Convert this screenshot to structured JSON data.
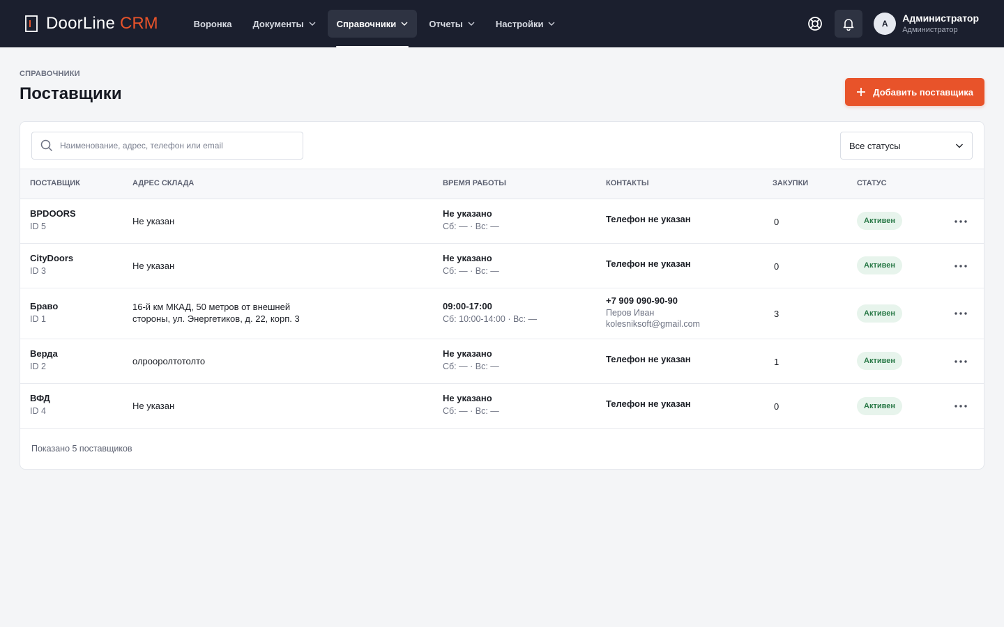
{
  "brand": {
    "name": "DoorLine",
    "accent": "CRM",
    "accent_color": "#e8532a"
  },
  "nav": [
    {
      "label": "Воронка",
      "dropdown": false,
      "active": false
    },
    {
      "label": "Документы",
      "dropdown": true,
      "active": false
    },
    {
      "label": "Справочники",
      "dropdown": true,
      "active": true
    },
    {
      "label": "Отчеты",
      "dropdown": true,
      "active": false
    },
    {
      "label": "Настройки",
      "dropdown": true,
      "active": false
    }
  ],
  "user": {
    "initial": "А",
    "name": "Администратор",
    "role": "Администратор"
  },
  "page": {
    "breadcrumb": "СПРАВОЧНИКИ",
    "title": "Поставщики",
    "add_button": "Добавить поставщика"
  },
  "search": {
    "placeholder": "Наименование, адрес, телефон или email",
    "value": ""
  },
  "status_filter": {
    "selected": "Все статусы"
  },
  "table": {
    "headers": [
      "ПОСТАВЩИК",
      "АДРЕС СКЛАДА",
      "ВРЕМЯ РАБОТЫ",
      "КОНТАКТЫ",
      "ЗАКУПКИ",
      "СТАТУС"
    ],
    "rows": [
      {
        "name": "BPDOORS",
        "id": "ID 5",
        "address": "Не указан",
        "hours": "Не указано",
        "weekend": "Сб: — · Вс: —",
        "phone": "Телефон не указан",
        "contact_person": "",
        "email": "",
        "purchases": "0",
        "status": "Активен"
      },
      {
        "name": "CityDoors",
        "id": "ID 3",
        "address": "Не указан",
        "hours": "Не указано",
        "weekend": "Сб: — · Вс: —",
        "phone": "Телефон не указан",
        "contact_person": "",
        "email": "",
        "purchases": "0",
        "status": "Активен"
      },
      {
        "name": "Браво",
        "id": "ID 1",
        "address": "16-й км МКАД, 50 метров от внешней стороны, ул. Энергетиков, д. 22, корп. 3",
        "hours": "09:00-17:00",
        "weekend": "Сб: 10:00-14:00 · Вс: —",
        "phone": "+7 909 090-90-90",
        "contact_person": "Перов Иван",
        "email": "kolesniksoft@gmail.com",
        "purchases": "3",
        "status": "Активен"
      },
      {
        "name": "Верда",
        "id": "ID 2",
        "address": "олрооролтотолто",
        "hours": "Не указано",
        "weekend": "Сб: — · Вс: —",
        "phone": "Телефон не указан",
        "contact_person": "",
        "email": "",
        "purchases": "1",
        "status": "Активен"
      },
      {
        "name": "ВФД",
        "id": "ID 4",
        "address": "Не указан",
        "hours": "Не указано",
        "weekend": "Сб: — · Вс: —",
        "phone": "Телефон не указан",
        "contact_person": "",
        "email": "",
        "purchases": "0",
        "status": "Активен"
      }
    ]
  },
  "footer": {
    "summary": "Показано 5 поставщиков"
  },
  "icons": {
    "help": "lifebuoy-icon",
    "notifications": "bell-icon",
    "search": "search-icon",
    "add": "plus-icon",
    "more": "more-dots-icon"
  },
  "colors": {
    "topbar": "#1b1f2e",
    "accent": "#e8532a",
    "badge_bg": "#e7f4ec",
    "badge_text": "#2a7a48"
  }
}
